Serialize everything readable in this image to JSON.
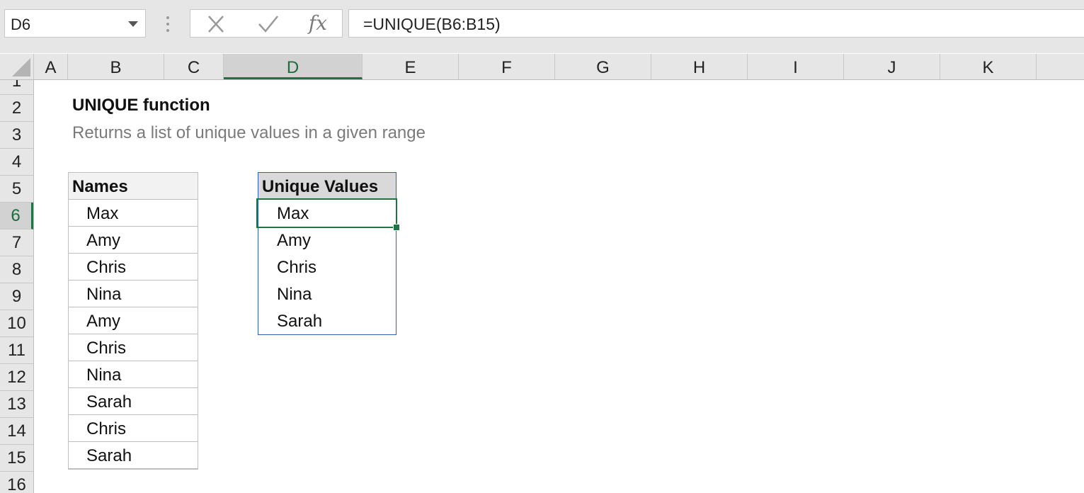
{
  "name_box": {
    "value": "D6"
  },
  "formula_bar": {
    "cancel_icon": "x-icon",
    "enter_icon": "checkmark-icon",
    "insert_function_label": "fx",
    "formula": "=UNIQUE(B6:B15)"
  },
  "columns": [
    "A",
    "B",
    "C",
    "D",
    "E",
    "F",
    "G",
    "H",
    "I",
    "J",
    "K"
  ],
  "selected_column": "D",
  "rows": [
    "1",
    "2",
    "3",
    "4",
    "5",
    "6",
    "7",
    "8",
    "9",
    "10",
    "11",
    "12",
    "13",
    "14",
    "15",
    "16"
  ],
  "selected_row": "6",
  "sheet": {
    "title": "UNIQUE function",
    "subtitle": "Returns a list of unique values in a given range",
    "names_table": {
      "header": "Names",
      "items": [
        "Max",
        "Amy",
        "Chris",
        "Nina",
        "Amy",
        "Chris",
        "Nina",
        "Sarah",
        "Chris",
        "Sarah"
      ]
    },
    "unique_table": {
      "header": "Unique Values",
      "items": [
        "Max",
        "Amy",
        "Chris",
        "Nina",
        "Sarah"
      ]
    }
  },
  "colors": {
    "accent": "#217346",
    "spill_border": "#2f5fb3"
  }
}
